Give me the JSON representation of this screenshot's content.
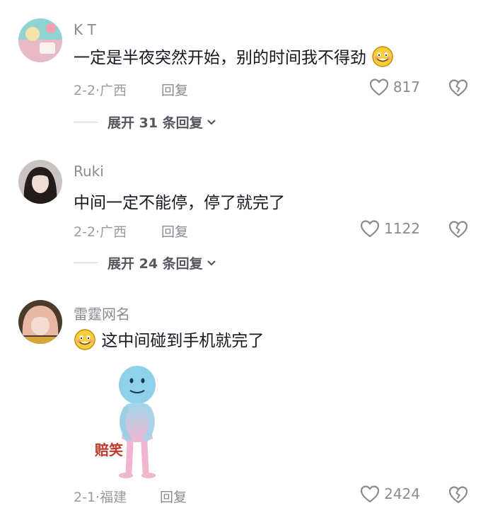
{
  "comments": [
    {
      "username": "K T",
      "text": "一定是半夜突然开始，别的时间我不得劲",
      "date": "2-2",
      "location": "广西",
      "reply_label": "回复",
      "likes": "817",
      "expand_label": "展开 31 条回复"
    },
    {
      "username": "Ruki",
      "text": "中间一定不能停，停了就完了",
      "date": "2-2",
      "location": "广西",
      "reply_label": "回复",
      "likes": "1122",
      "expand_label": "展开 24 条回复"
    },
    {
      "username": "雷霆网名",
      "text": "这中间碰到手机就完了",
      "date": "2-1",
      "location": "福建",
      "reply_label": "回复",
      "likes": "2424",
      "sticker_caption": "赔笑"
    }
  ],
  "colors": {
    "username": "#8a8b91",
    "text": "#161823",
    "meta": "#9a9ba0",
    "sticker_caption": "#c0392b"
  },
  "icons": [
    "heart-icon",
    "broken-heart-icon",
    "chevron-down-icon",
    "smile-emoji-icon"
  ]
}
